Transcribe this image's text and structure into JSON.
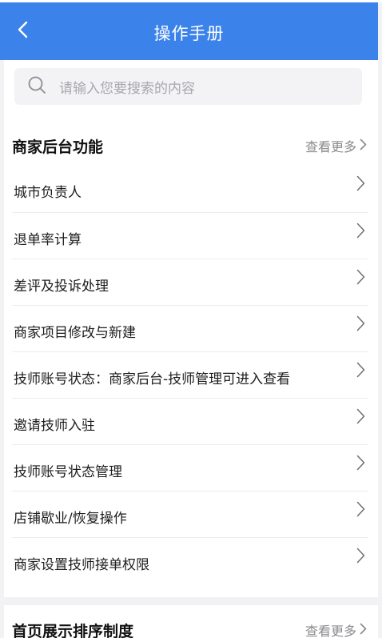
{
  "header": {
    "title": "操作手册",
    "back_icon": "chevron-left-icon"
  },
  "search": {
    "placeholder": "请输入您要搜索的内容",
    "icon": "search-icon"
  },
  "sections": [
    {
      "title": "商家后台功能",
      "more_label": "查看更多",
      "items": [
        {
          "label": "城市负责人"
        },
        {
          "label": "退单率计算"
        },
        {
          "label": "差评及投诉处理"
        },
        {
          "label": "商家项目修改与新建"
        },
        {
          "label": "技师账号状态：商家后台-技师管理可进入查看"
        },
        {
          "label": "邀请技师入驻"
        },
        {
          "label": "技师账号状态管理"
        },
        {
          "label": "店铺歇业/恢复操作"
        },
        {
          "label": "商家设置技师接单权限"
        }
      ]
    },
    {
      "title": "首页展示排序制度",
      "more_label": "查看更多"
    }
  ],
  "colors": {
    "header_bg": "#3b82ea",
    "page_bg": "#f2f2f4",
    "muted_text": "#8a8a8e"
  }
}
